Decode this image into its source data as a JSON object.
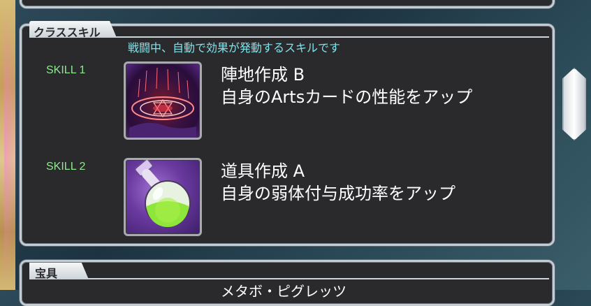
{
  "section": {
    "title": "クラススキル",
    "subtitle": "戦闘中、自動で効果が発動するスキルです"
  },
  "skills": [
    {
      "label": "SKILL 1",
      "name": "陣地作成 B",
      "description": "自身のArtsカードの性能をアップ",
      "icon": "magic-circle-icon"
    },
    {
      "label": "SKILL 2",
      "name": "道具作成 A",
      "description": "自身の弱体付与成功率をアップ",
      "icon": "potion-flask-icon"
    }
  ],
  "noble_phantasm": {
    "title": "宝具",
    "name": "メタボ・ピグレッツ"
  },
  "colors": {
    "panel_bg": "#2a2a2d",
    "subtitle": "#7fe3ea",
    "skill_label": "#8fe88f"
  }
}
